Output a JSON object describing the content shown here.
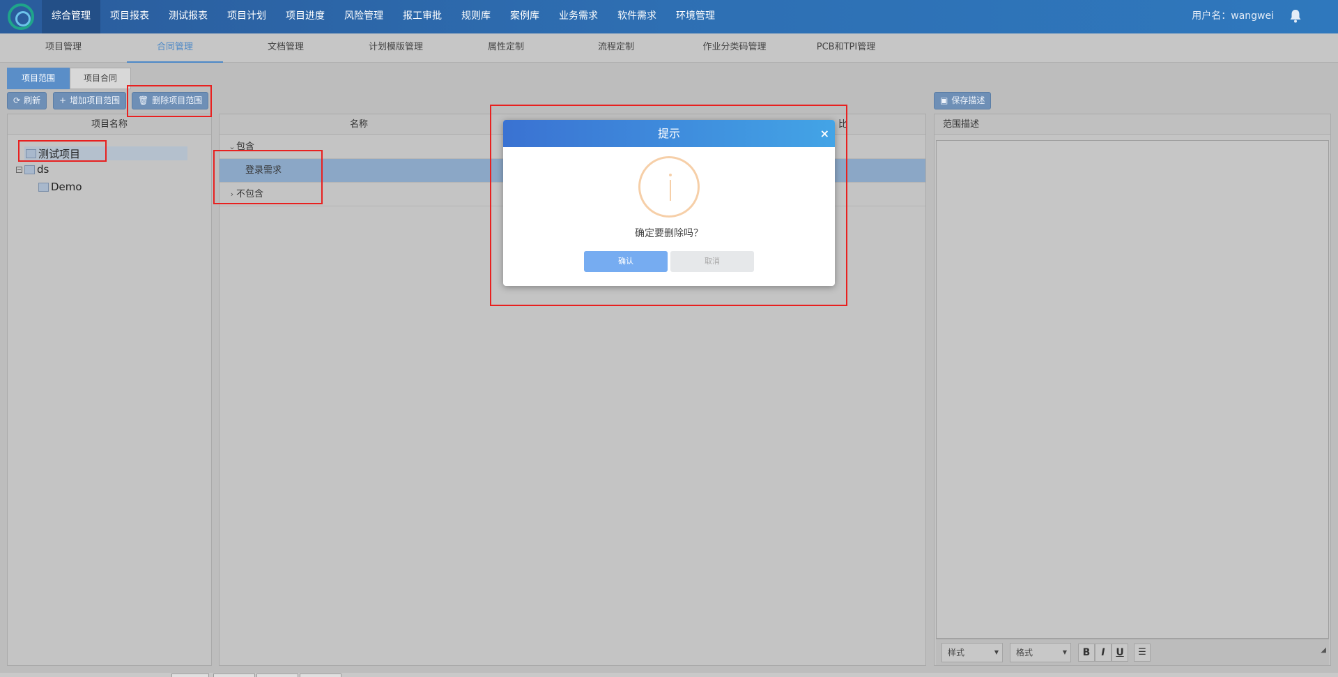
{
  "nav": {
    "items": [
      "综合管理",
      "项目报表",
      "测试报表",
      "项目计划",
      "项目进度",
      "风险管理",
      "报工审批",
      "规则库",
      "案例库",
      "业务需求",
      "软件需求",
      "环境管理"
    ],
    "active_index": 0,
    "user_label": "用户名：wangwei"
  },
  "subnav": {
    "items": [
      "项目管理",
      "合同管理",
      "文档管理",
      "计划模版管理",
      "属性定制",
      "流程定制",
      "作业分类码管理",
      "PCB和TPI管理"
    ],
    "active_index": 1
  },
  "tabs": {
    "scope": "项目范围",
    "contract": "项目合同"
  },
  "toolbar": {
    "refresh": "刷新",
    "add_scope": "增加项目范围",
    "delete_scope": "删除项目范围",
    "save_desc": "保存描述"
  },
  "left_panel": {
    "header": "项目名称",
    "tree": [
      {
        "label": "测试项目"
      },
      {
        "label": "ds"
      },
      {
        "label": "Demo"
      }
    ]
  },
  "mid_panel": {
    "header": "名称",
    "header_right_fragment": "比",
    "rows": [
      {
        "label": "包含"
      },
      {
        "label": "登录需求"
      },
      {
        "label": "不包含"
      }
    ]
  },
  "right_panel": {
    "header": "范围描述",
    "style_select": "样式",
    "format_select": "格式",
    "bold": "B",
    "italic": "I",
    "underline": "U"
  },
  "dialog": {
    "title": "提示",
    "close": "×",
    "message": "确定要删除吗？",
    "confirm": "确认",
    "cancel": "取消"
  },
  "colors": {
    "nav_bg": "#2e6fb3",
    "accent": "#5a8ec8",
    "annotation_red": "#e8201f",
    "dialog_header": "#43a4e6",
    "info_icon": "#f6cfa8"
  }
}
